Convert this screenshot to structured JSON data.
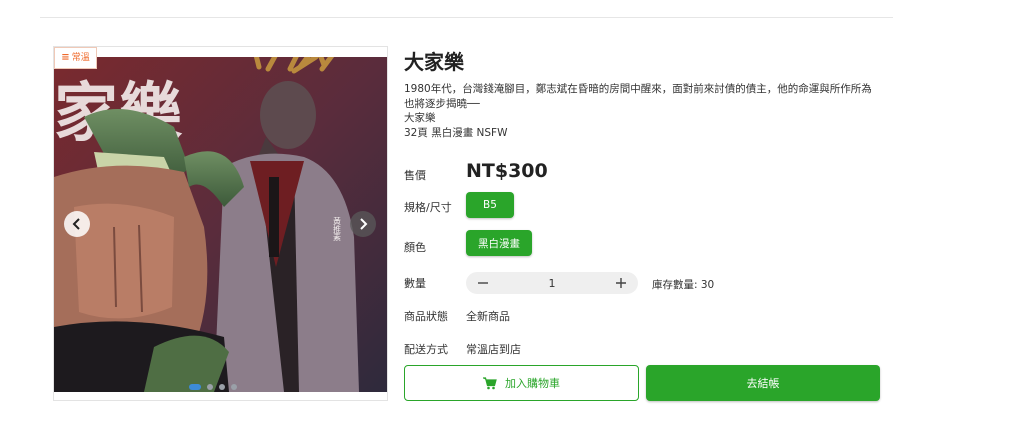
{
  "product": {
    "title": "大家樂",
    "description_lines": [
      "1980年代，台灣錢淹腳目，鄭志斌在昏暗的房間中醒來，面對前來討債的債主，他的命運與所作所為",
      "也將逐步揭曉──",
      "大家樂",
      "32頁 黑白漫畫 NSFW"
    ]
  },
  "gallery": {
    "logo_text": "常溫",
    "artwork_title": "家樂",
    "artwork_signature": "黃推素",
    "slide_count": 4,
    "active_slide": 1,
    "prev_icon": "chevron-left-icon",
    "next_icon": "chevron-right-icon"
  },
  "fields": {
    "price_label": "售價",
    "price_value": "NT$300",
    "spec_label": "規格/尺寸",
    "spec_option": "B5",
    "color_label": "顏色",
    "color_option": "黑白漫畫",
    "qty_label": "數量",
    "qty_value": "1",
    "stock_text": "庫存數量: 30",
    "condition_label": "商品狀態",
    "condition_value": "全新商品",
    "shipping_label": "配送方式",
    "shipping_value": "常溫店到店"
  },
  "actions": {
    "add_to_cart": "加入購物車",
    "checkout": "去結帳",
    "cart_icon": "cart-icon"
  },
  "colors": {
    "accent": "#2aa52a",
    "logo": "#ef6a2b",
    "dot_active": "#3d8bd8"
  }
}
